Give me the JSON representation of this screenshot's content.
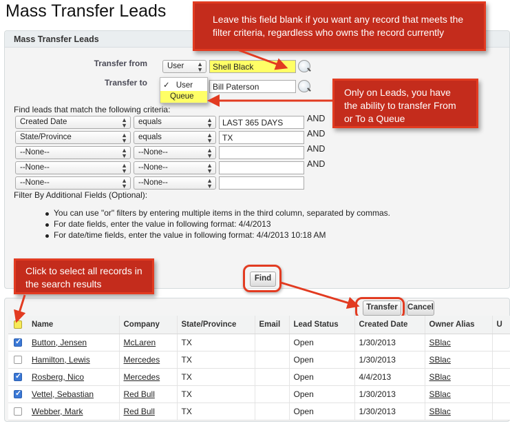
{
  "page": {
    "title": "Mass Transfer Leads"
  },
  "panel": {
    "title": "Mass Transfer Leads"
  },
  "transfer": {
    "from_label": "Transfer from",
    "from_type": "User",
    "from_value": "Shell Black",
    "to_label": "Transfer to",
    "to_value": "Bill Paterson",
    "to_type_options": [
      {
        "check": "✓",
        "label": "User"
      },
      {
        "check": "",
        "label": "Queue"
      }
    ]
  },
  "criteria": {
    "heading": "Find leads that match the following criteria:",
    "rows": [
      {
        "field": "Created Date",
        "operator": "equals",
        "value": "LAST 365 DAYS",
        "conj": "AND"
      },
      {
        "field": "State/Province",
        "operator": "equals",
        "value": "TX",
        "conj": "AND"
      },
      {
        "field": "--None--",
        "operator": "--None--",
        "value": "",
        "conj": "AND"
      },
      {
        "field": "--None--",
        "operator": "--None--",
        "value": "",
        "conj": "AND"
      },
      {
        "field": "--None--",
        "operator": "--None--",
        "value": "",
        "conj": ""
      }
    ],
    "additional_label": "Filter By Additional Fields (Optional):",
    "notes": [
      "You can use \"or\" filters by entering multiple items in the third column, separated by commas.",
      "For date fields, enter the value in following format: 4/4/2013",
      "For date/time fields, enter the value in following format: 4/4/2013 10:18 AM"
    ]
  },
  "buttons": {
    "find": "Find",
    "transfer": "Transfer",
    "cancel": "Cancel"
  },
  "callouts": {
    "blank_field": "Leave this field blank if you want any record that meets the filter criteria, regardless who owns the record currently",
    "queue": "Only on Leads, you have the ability to transfer From or To a Queue",
    "select_all": "Click to select all records in the search results"
  },
  "table": {
    "columns": [
      "Name",
      "Company",
      "State/Province",
      "Email",
      "Lead Status",
      "Created Date",
      "Owner Alias",
      "U"
    ],
    "rows": [
      {
        "checked": true,
        "name": "Button, Jensen",
        "company": "McLaren",
        "state": "TX",
        "email": "",
        "status": "Open",
        "created": "1/30/2013",
        "owner": "SBlac"
      },
      {
        "checked": false,
        "name": "Hamilton, Lewis",
        "company": "Mercedes",
        "state": "TX",
        "email": "",
        "status": "Open",
        "created": "1/30/2013",
        "owner": "SBlac"
      },
      {
        "checked": true,
        "name": "Rosberg, Nico",
        "company": "Mercedes",
        "state": "TX",
        "email": "",
        "status": "Open",
        "created": "4/4/2013",
        "owner": "SBlac"
      },
      {
        "checked": true,
        "name": "Vettel, Sebastian",
        "company": "Red Bull",
        "state": "TX",
        "email": "",
        "status": "Open",
        "created": "1/30/2013",
        "owner": "SBlac"
      },
      {
        "checked": false,
        "name": "Webber, Mark",
        "company": "Red Bull",
        "state": "TX",
        "email": "",
        "status": "Open",
        "created": "1/30/2013",
        "owner": "SBlac"
      }
    ]
  },
  "colors": {
    "callout": "#c42c1c",
    "ring": "#e23b21",
    "highlight": "#ffff66",
    "checkbox": "#3a78d6"
  },
  "icons": {
    "lookup": "magnifier-lookup-icon",
    "select_arrow": "up-down-arrow-icon",
    "check": "checkmark-icon"
  }
}
